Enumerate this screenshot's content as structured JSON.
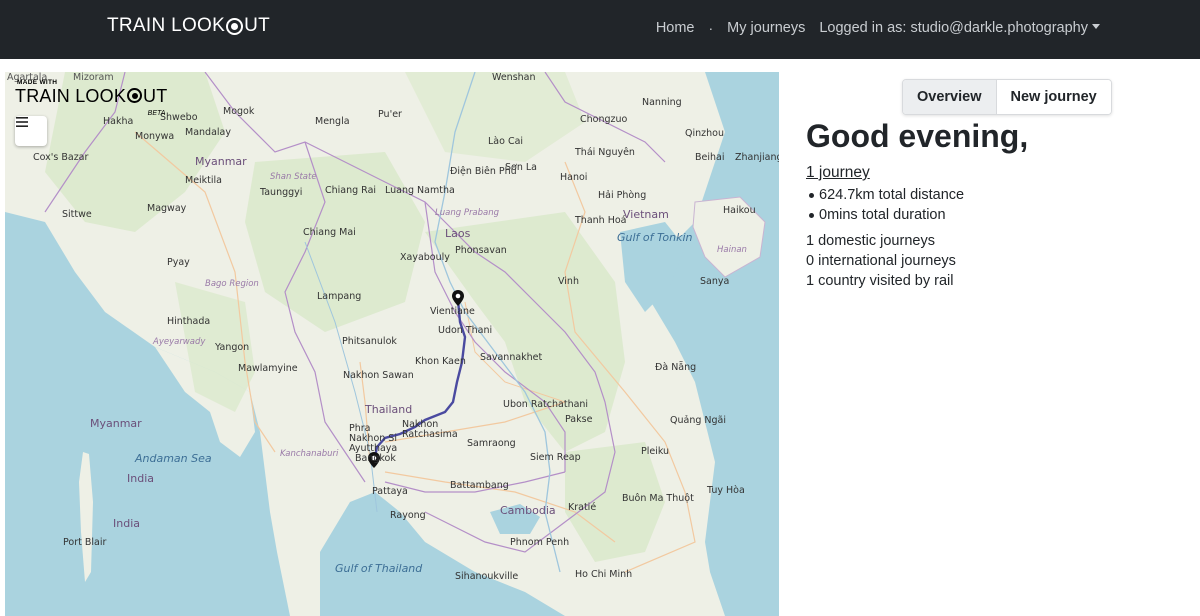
{
  "navbar": {
    "brand_prefix": "TRAIN LOOK",
    "brand_suffix": "UT",
    "links": {
      "home": "Home",
      "separator": "·",
      "my_journeys": "My journeys"
    },
    "user_menu": "Logged in as: studio@darkle.photography"
  },
  "map": {
    "badge_small": "MADE WITH",
    "badge_prefix": "TRAIN LOOK",
    "badge_suffix": "UT",
    "badge_beta": "BETA",
    "route_color": "#4a4aa0",
    "labels": {
      "agartala": "Agartala",
      "mizoram": "Mizoram",
      "wenshan": "Wenshan",
      "chongzuo": "Chongzuo",
      "nanning": "Nanning",
      "shwebo": "Shwebo",
      "monywa": "Monywa",
      "mandalay": "Mandalay",
      "mogok": "Mogok",
      "mengla": "Mengla",
      "puer": "Pu'er",
      "hakha": "Hakha",
      "coxsbazar": "Cox's Bazar",
      "myanmar": "Myanmar",
      "meiktila": "Meiktila",
      "shanstate": "Shan State",
      "taunggyi": "Taunggyi",
      "magway": "Magway",
      "sittwe": "Sittwe",
      "pyay": "Pyay",
      "baganregion": "Bago Region",
      "hinthada": "Hinthada",
      "yangon": "Yangon",
      "mawlamyine": "Mawlamyine",
      "ayeyarwady": "Ayeyarwady",
      "myanmar2": "Myanmar",
      "thailand": "Thailand",
      "chiangrai": "Chiang Rai",
      "chiangmai": "Chiang Mai",
      "lampang": "Lampang",
      "phitsanulok": "Phitsanulok",
      "nakhonsawan": "Nakhon Sawan",
      "phranakhon": "Phra Nakhon Si Ayutthaya",
      "bangkok": "Bangkok",
      "pattaya": "Pattaya",
      "rayong": "Rayong",
      "kanchanaburi": "Kanchanaburi",
      "laos": "Laos",
      "luangnamtha": "Luang Namtha",
      "luangprabang": "Luang Prabang",
      "xayabouly": "Xayabouly",
      "phonsavan": "Phonsavan",
      "vientiane": "Vientiane",
      "udonthani": "Udon Thani",
      "khonkaen": "Khon Kaen",
      "savannakhet": "Savannakhet",
      "ubon": "Ubon Ratchathani",
      "nakhonratchasima": "Nakhon Ratchasima",
      "pakse": "Pakse",
      "surin": "Samraong",
      "siem": "Siem Reap",
      "cambodia": "Cambodia",
      "battambang": "Battambang",
      "phnompenh": "Phnom Penh",
      "sihanoukville": "Sihanoukville",
      "kratie": "Kratié",
      "hochiminh": "Ho Chi Minh",
      "hanoi": "Hanoi",
      "haiphong": "Hải Phòng",
      "vietnam": "Vietnam",
      "thanhhoa": "Thanh Hoá",
      "vinh": "Vinh",
      "danang": "Đà Nẵng",
      "quangngai": "Quảng Ngãi",
      "pleiku": "Pleiku",
      "buonmathuot": "Buôn Ma Thuột",
      "tuyhoa": "Tuy Hòa",
      "haikou": "Haikou",
      "sanya": "Sanya",
      "hainan": "Hainan",
      "gulftonkin": "Gulf of Tonkin",
      "andaman": "Andaman Sea",
      "gulfthailand": "Gulf of Thailand",
      "portblair": "Port Blair",
      "india": "India",
      "india2": "India",
      "thainguyen": "Thái Nguyên",
      "laocai": "Lào Cai",
      "dienbien": "Điện Biên Phủ",
      "sonla": "Sơn La",
      "qinzhou": "Qinzhou",
      "beihai": "Beihai",
      "zhanjiang": "Zhanjiang"
    }
  },
  "panel": {
    "tabs": {
      "overview": "Overview",
      "new_journey": "New journey"
    },
    "greeting": "Good evening,",
    "journey_link": "1 journey",
    "stats": {
      "distance": "624.7km total distance",
      "duration": "0mins total duration"
    },
    "counts": {
      "domestic": "1 domestic journeys",
      "international": "0 international journeys",
      "countries": "1 country visited by rail"
    }
  }
}
